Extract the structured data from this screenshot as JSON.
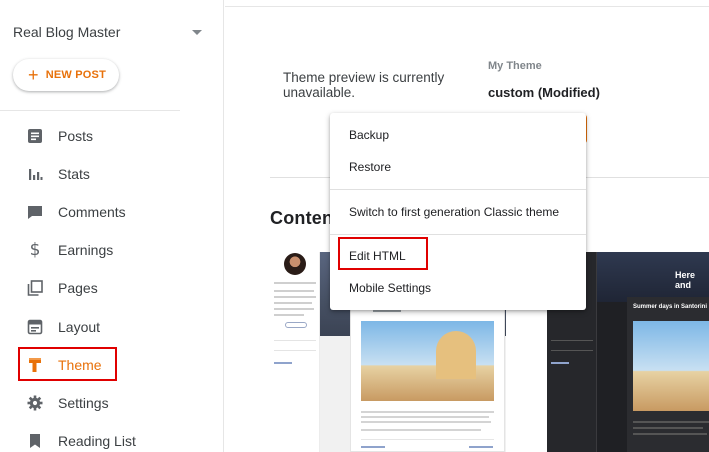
{
  "sidebar": {
    "blog_name": "Real Blog Master",
    "new_post_label": "NEW POST",
    "items": [
      {
        "label": "Posts",
        "icon": "posts-icon"
      },
      {
        "label": "Stats",
        "icon": "stats-icon"
      },
      {
        "label": "Comments",
        "icon": "comments-icon"
      },
      {
        "label": "Earnings",
        "icon": "dollar-icon"
      },
      {
        "label": "Pages",
        "icon": "pages-icon"
      },
      {
        "label": "Layout",
        "icon": "layout-icon"
      },
      {
        "label": "Theme",
        "icon": "theme-icon",
        "active": true
      },
      {
        "label": "Settings",
        "icon": "gear-icon"
      },
      {
        "label": "Reading List",
        "icon": "bookmark-icon"
      }
    ]
  },
  "main": {
    "preview_message": "Theme preview is currently unavailable.",
    "my_theme_label": "My Theme",
    "my_theme_value": "custom (Modified)",
    "content_heading": "Conten"
  },
  "thumbnails": {
    "dark_title": "Here and",
    "dark_post_title": "Summer days in Santorini"
  },
  "menu": {
    "items": [
      "Backup",
      "Restore",
      "Switch to first generation Classic theme",
      "Edit HTML",
      "Mobile Settings"
    ]
  },
  "colors": {
    "accent": "#e8710a",
    "highlight": "#e00000",
    "text": "#3c4043"
  }
}
